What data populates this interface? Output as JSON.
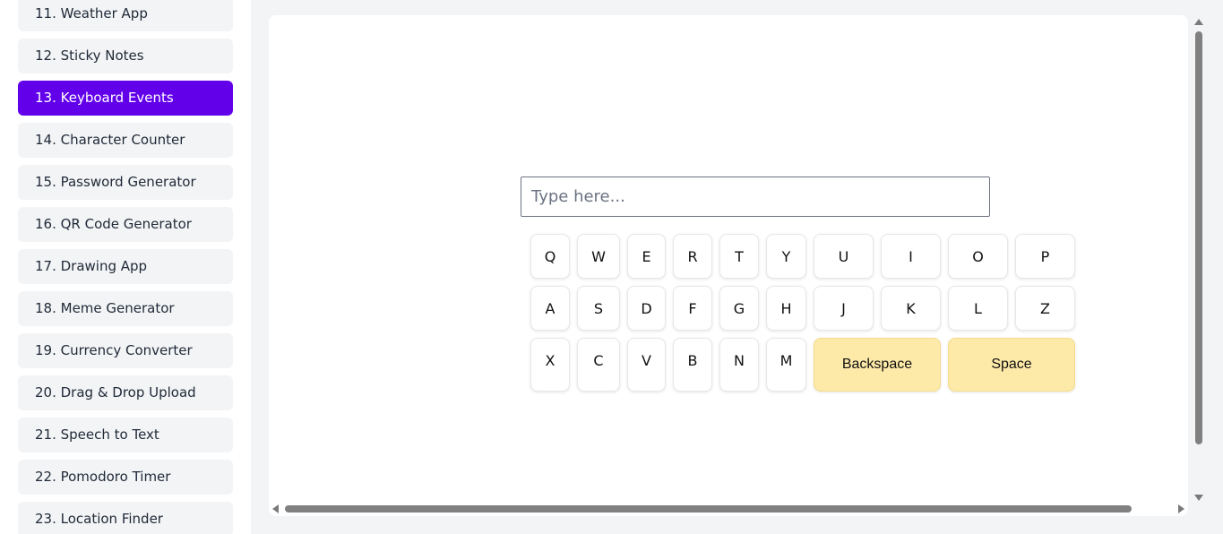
{
  "sidebar": {
    "items": [
      {
        "label": "11. Weather App",
        "active": false
      },
      {
        "label": "12. Sticky Notes",
        "active": false
      },
      {
        "label": "13. Keyboard Events",
        "active": true
      },
      {
        "label": "14. Character Counter",
        "active": false
      },
      {
        "label": "15. Password Generator",
        "active": false
      },
      {
        "label": "16. QR Code Generator",
        "active": false
      },
      {
        "label": "17. Drawing App",
        "active": false
      },
      {
        "label": "18. Meme Generator",
        "active": false
      },
      {
        "label": "19. Currency Converter",
        "active": false
      },
      {
        "label": "20. Drag & Drop Upload",
        "active": false
      },
      {
        "label": "21. Speech to Text",
        "active": false
      },
      {
        "label": "22. Pomodoro Timer",
        "active": false
      },
      {
        "label": "23. Location Finder",
        "active": false
      }
    ]
  },
  "main": {
    "input": {
      "placeholder": "Type here...",
      "value": ""
    },
    "keyboard": {
      "row1": [
        "Q",
        "W",
        "E",
        "R",
        "T",
        "Y",
        "U",
        "I",
        "O",
        "P"
      ],
      "row2": [
        "A",
        "S",
        "D",
        "F",
        "G",
        "H",
        "J",
        "K",
        "L",
        "Z"
      ],
      "row3": [
        "X",
        "C",
        "V",
        "B",
        "N",
        "M"
      ],
      "backspace_label": "Backspace",
      "space_label": "Space"
    }
  },
  "colors": {
    "accent": "#6200ea",
    "wide_key": "#fde9a8",
    "nav_bg": "#f3f4f6"
  }
}
